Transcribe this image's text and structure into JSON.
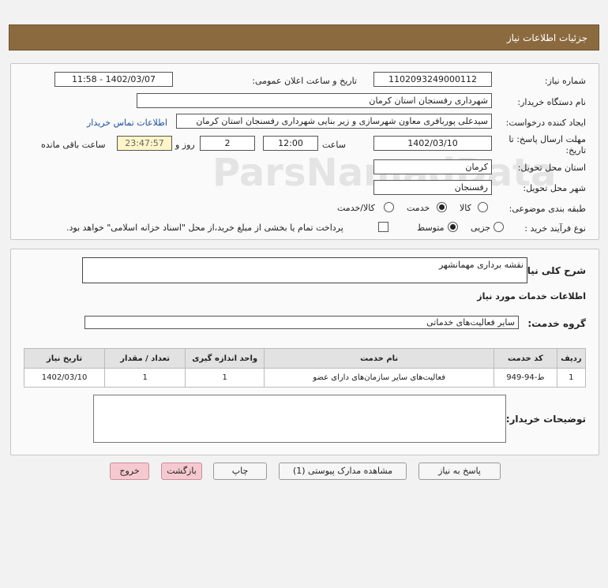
{
  "header": {
    "title": "جزئیات اطلاعات نیاز"
  },
  "info": {
    "need_number_label": "شماره نیاز:",
    "need_number": "1102093249000112",
    "announce_label": "تاریخ و ساعت اعلان عمومی:",
    "announce_value": "1402/03/07 - 11:58",
    "buyer_org_label": "نام دستگاه خریدار:",
    "buyer_org": "شهرداری رفسنجان استان کرمان",
    "creator_label": "ایجاد کننده درخواست:",
    "creator": "سیدعلی پوربافری معاون شهرسازی و زیر بنایی شهرداری رفسنجان استان کرمان",
    "contact_link": "اطلاعات تماس خریدار",
    "deadline_label_1": "مهلت ارسال پاسخ: تا",
    "deadline_label_2": "تاریخ:",
    "deadline_date": "1402/03/10",
    "time_label": "ساعت",
    "deadline_time": "12:00",
    "days_value": "2",
    "days_label": "روز و",
    "remaining_time": "23:47:57",
    "remaining_label": "ساعت باقی مانده",
    "province_label": "استان محل تحویل:",
    "province": "کرمان",
    "city_label": "شهر محل تحویل:",
    "city": "رفسنجان",
    "category_label": "طبقه بندی موضوعی:",
    "category_options": [
      "کالا",
      "خدمت",
      "کالا/خدمت"
    ],
    "category_selected": "خدمت",
    "process_label": "نوع فرآیند خرید :",
    "process_options": [
      "جزیی",
      "متوسط"
    ],
    "process_selected": "متوسط",
    "payment_note": "پرداخت تمام یا بخشی از مبلغ خرید،از محل \"اسناد خزانه اسلامی\" خواهد بود."
  },
  "details": {
    "summary_label": "شرح کلی نیاز:",
    "summary": "نقشه برداری مهمانشهر",
    "services_heading": "اطلاعات خدمات مورد نیاز",
    "service_group_label": "گروه خدمت:",
    "service_group": "سایر فعالیت‌های خدماتی",
    "table": {
      "headers": [
        "ردیف",
        "کد خدمت",
        "نام خدمت",
        "واحد اندازه گیری",
        "تعداد / مقدار",
        "تاریخ نیاز"
      ],
      "rows": [
        [
          "1",
          "ط-94-949",
          "فعالیت‌های سایر سازمان‌های دارای عضو",
          "1",
          "1",
          "1402/03/10"
        ]
      ]
    },
    "buyer_notes_label": "توضیحات خریدار:",
    "buyer_notes": ""
  },
  "buttons": {
    "reply": "پاسخ به نیاز",
    "docs": "مشاهده مدارک پیوستی (1)",
    "print": "چاپ",
    "back": "بازگشت",
    "exit": "خروج"
  },
  "colors": {
    "header_bg": "#8c6a3f",
    "pink_button": "#f6c9d0",
    "link": "#1a4fa3"
  }
}
